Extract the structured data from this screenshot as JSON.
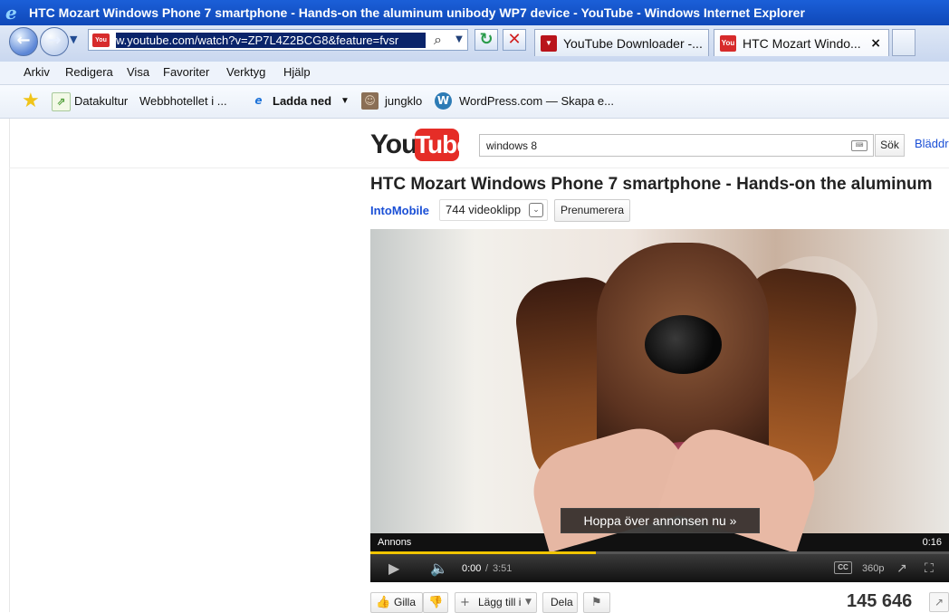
{
  "window": {
    "title": "HTC Mozart Windows Phone 7 smartphone - Hands-on the aluminum unibody WP7 device - YouTube - Windows Internet Explorer",
    "ie_icon": "internet-explorer-icon"
  },
  "toolbar": {
    "address": "w.youtube.com/watch?v=ZP7L4Z2BCG8&feature=fvsr",
    "back_icon": "back-arrow-icon",
    "forward_icon": "forward-arrow-icon",
    "search_icon": "search-icon",
    "refresh_icon": "refresh-icon",
    "stop_icon": "stop-icon"
  },
  "tabs": [
    {
      "label": "YouTube Downloader -...",
      "icon": "youtube-downloader-icon"
    },
    {
      "label": "HTC Mozart Windo...",
      "icon": "youtube-icon",
      "close": "×"
    }
  ],
  "menu": [
    "Arkiv",
    "Redigera",
    "Visa",
    "Favoriter",
    "Verktyg",
    "Hjälp"
  ],
  "favorites": [
    {
      "label": "Datakultur",
      "icon": "datakultur-icon"
    },
    {
      "label": "Webbhotellet i ...",
      "icon": "none"
    },
    {
      "label": "Ladda ned",
      "icon": "ie-icon"
    },
    {
      "label": "jungklo",
      "icon": "profile-icon"
    },
    {
      "label": "WordPress.com — Skapa e...",
      "icon": "wordpress-icon"
    }
  ],
  "youtube": {
    "logo_you": "You",
    "logo_tube": "Tube",
    "search_value": "windows 8",
    "search_button": "Sök",
    "browse_link": "Bläddr",
    "video_title": "HTC Mozart Windows Phone 7 smartphone - Hands-on the aluminum",
    "channel": "IntoMobile",
    "video_count": "744 videoklipp",
    "subscribe": "Prenumerera",
    "skip_ad": "Hoppa över annonsen nu »",
    "ad_label": "Annons",
    "ad_remaining": "0:16",
    "time_current": "0:00",
    "time_separator": "/",
    "time_total": "3:51",
    "cc": "CC",
    "quality": "360p",
    "progress_fraction": 0.39,
    "like": "Gilla",
    "add_to": "Lägg till i",
    "share": "Dela",
    "views": "145 646",
    "colors": {
      "youtube_red": "#e52d27",
      "link_blue": "#1a4fd6",
      "progress_yellow": "#f0c400"
    }
  }
}
